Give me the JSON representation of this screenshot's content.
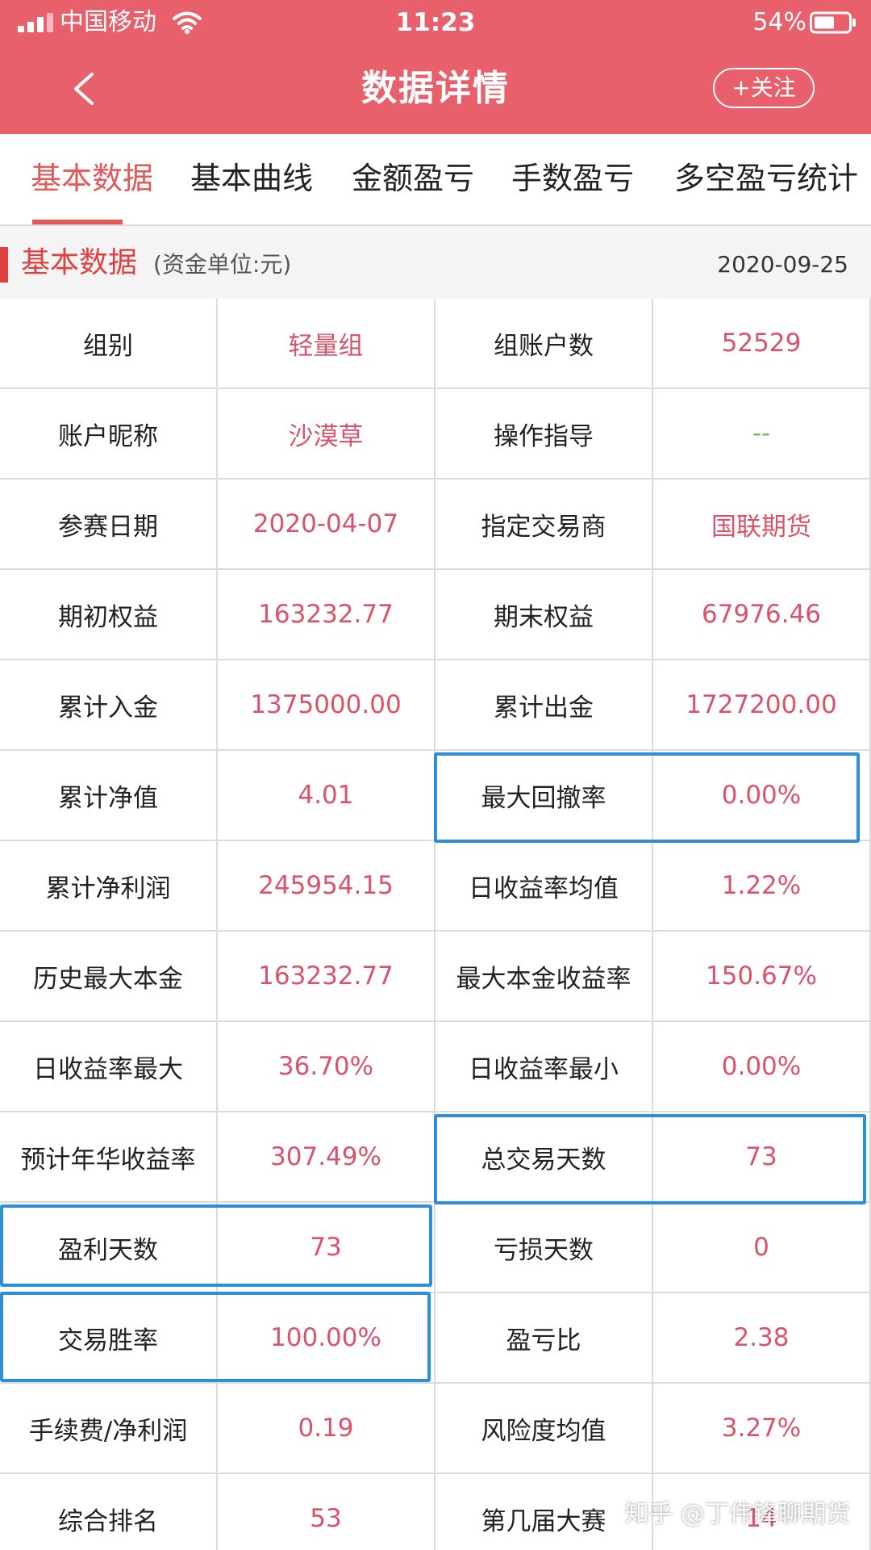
{
  "status_bar": {
    "carrier": "中国移动",
    "time": "11:23",
    "battery_percent": "54%"
  },
  "nav": {
    "title": "数据详情",
    "follow_label": "+关注"
  },
  "tabs": [
    {
      "label": "基本数据",
      "active": true
    },
    {
      "label": "基本曲线",
      "active": false
    },
    {
      "label": "金额盈亏",
      "active": false
    },
    {
      "label": "手数盈亏",
      "active": false
    },
    {
      "label": "多空盈亏统计",
      "active": false
    }
  ],
  "section": {
    "title": "基本数据",
    "unit": "(资金单位:元)",
    "date": "2020-09-25"
  },
  "rows": [
    [
      {
        "label": "组别",
        "value": "轻量组"
      },
      {
        "label": "组账户数",
        "value": "52529"
      }
    ],
    [
      {
        "label": "账户昵称",
        "value": "沙漠草"
      },
      {
        "label": "操作指导",
        "value": "--"
      }
    ],
    [
      {
        "label": "参赛日期",
        "value": "2020-04-07"
      },
      {
        "label": "指定交易商",
        "value": "国联期货"
      }
    ],
    [
      {
        "label": "期初权益",
        "value": "163232.77"
      },
      {
        "label": "期末权益",
        "value": "67976.46"
      }
    ],
    [
      {
        "label": "累计入金",
        "value": "1375000.00"
      },
      {
        "label": "累计出金",
        "value": "1727200.00"
      }
    ],
    [
      {
        "label": "累计净值",
        "value": "4.01"
      },
      {
        "label": "最大回撤率",
        "value": "0.00%"
      }
    ],
    [
      {
        "label": "累计净利润",
        "value": "245954.15"
      },
      {
        "label": "日收益率均值",
        "value": "1.22%"
      }
    ],
    [
      {
        "label": "历史最大本金",
        "value": "163232.77"
      },
      {
        "label": "最大本金收益率",
        "value": "150.67%"
      }
    ],
    [
      {
        "label": "日收益率最大",
        "value": "36.70%"
      },
      {
        "label": "日收益率最小",
        "value": "0.00%"
      }
    ],
    [
      {
        "label": "预计年华收益率",
        "value": "307.49%"
      },
      {
        "label": "总交易天数",
        "value": "73"
      }
    ],
    [
      {
        "label": "盈利天数",
        "value": "73"
      },
      {
        "label": "亏损天数",
        "value": "0"
      }
    ],
    [
      {
        "label": "交易胜率",
        "value": "100.00%"
      },
      {
        "label": "盈亏比",
        "value": "2.38"
      }
    ],
    [
      {
        "label": "手续费/净利润",
        "value": "0.19"
      },
      {
        "label": "风险度均值",
        "value": "3.27%"
      }
    ],
    [
      {
        "label": "综合排名",
        "value": "53"
      },
      {
        "label": "第几届大赛",
        "value": "14"
      }
    ]
  ],
  "colors": {
    "header_bg": "#e8606c",
    "accent_red": "#e05a5a",
    "value_red": "#d9536a",
    "highlight_blue": "#2f8fd6",
    "placeholder_green": "#6cbf5b"
  },
  "watermark": "知乎 @丁伟锋聊期货"
}
